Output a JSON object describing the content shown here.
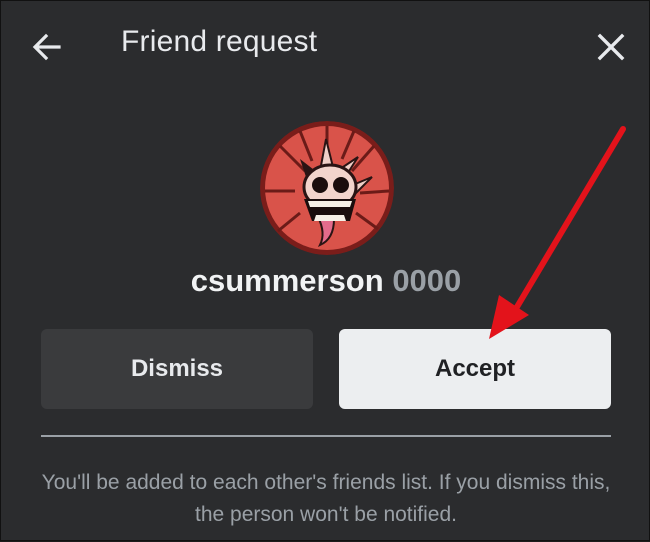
{
  "dialog": {
    "title": "Friend request",
    "back_icon": "arrow-left-icon",
    "close_icon": "close-icon"
  },
  "profile": {
    "username": "csummerson",
    "discriminator": "0000",
    "avatar_icon": "skull-avatar"
  },
  "actions": {
    "dismiss_label": "Dismiss",
    "accept_label": "Accept"
  },
  "info_text": "You'll be added to each other's friends list. If you dismiss this, the person won't be notified.",
  "colors": {
    "background": "#2b2c2e",
    "accent_arrow": "#e3131b",
    "avatar_red": "#d9534a"
  }
}
